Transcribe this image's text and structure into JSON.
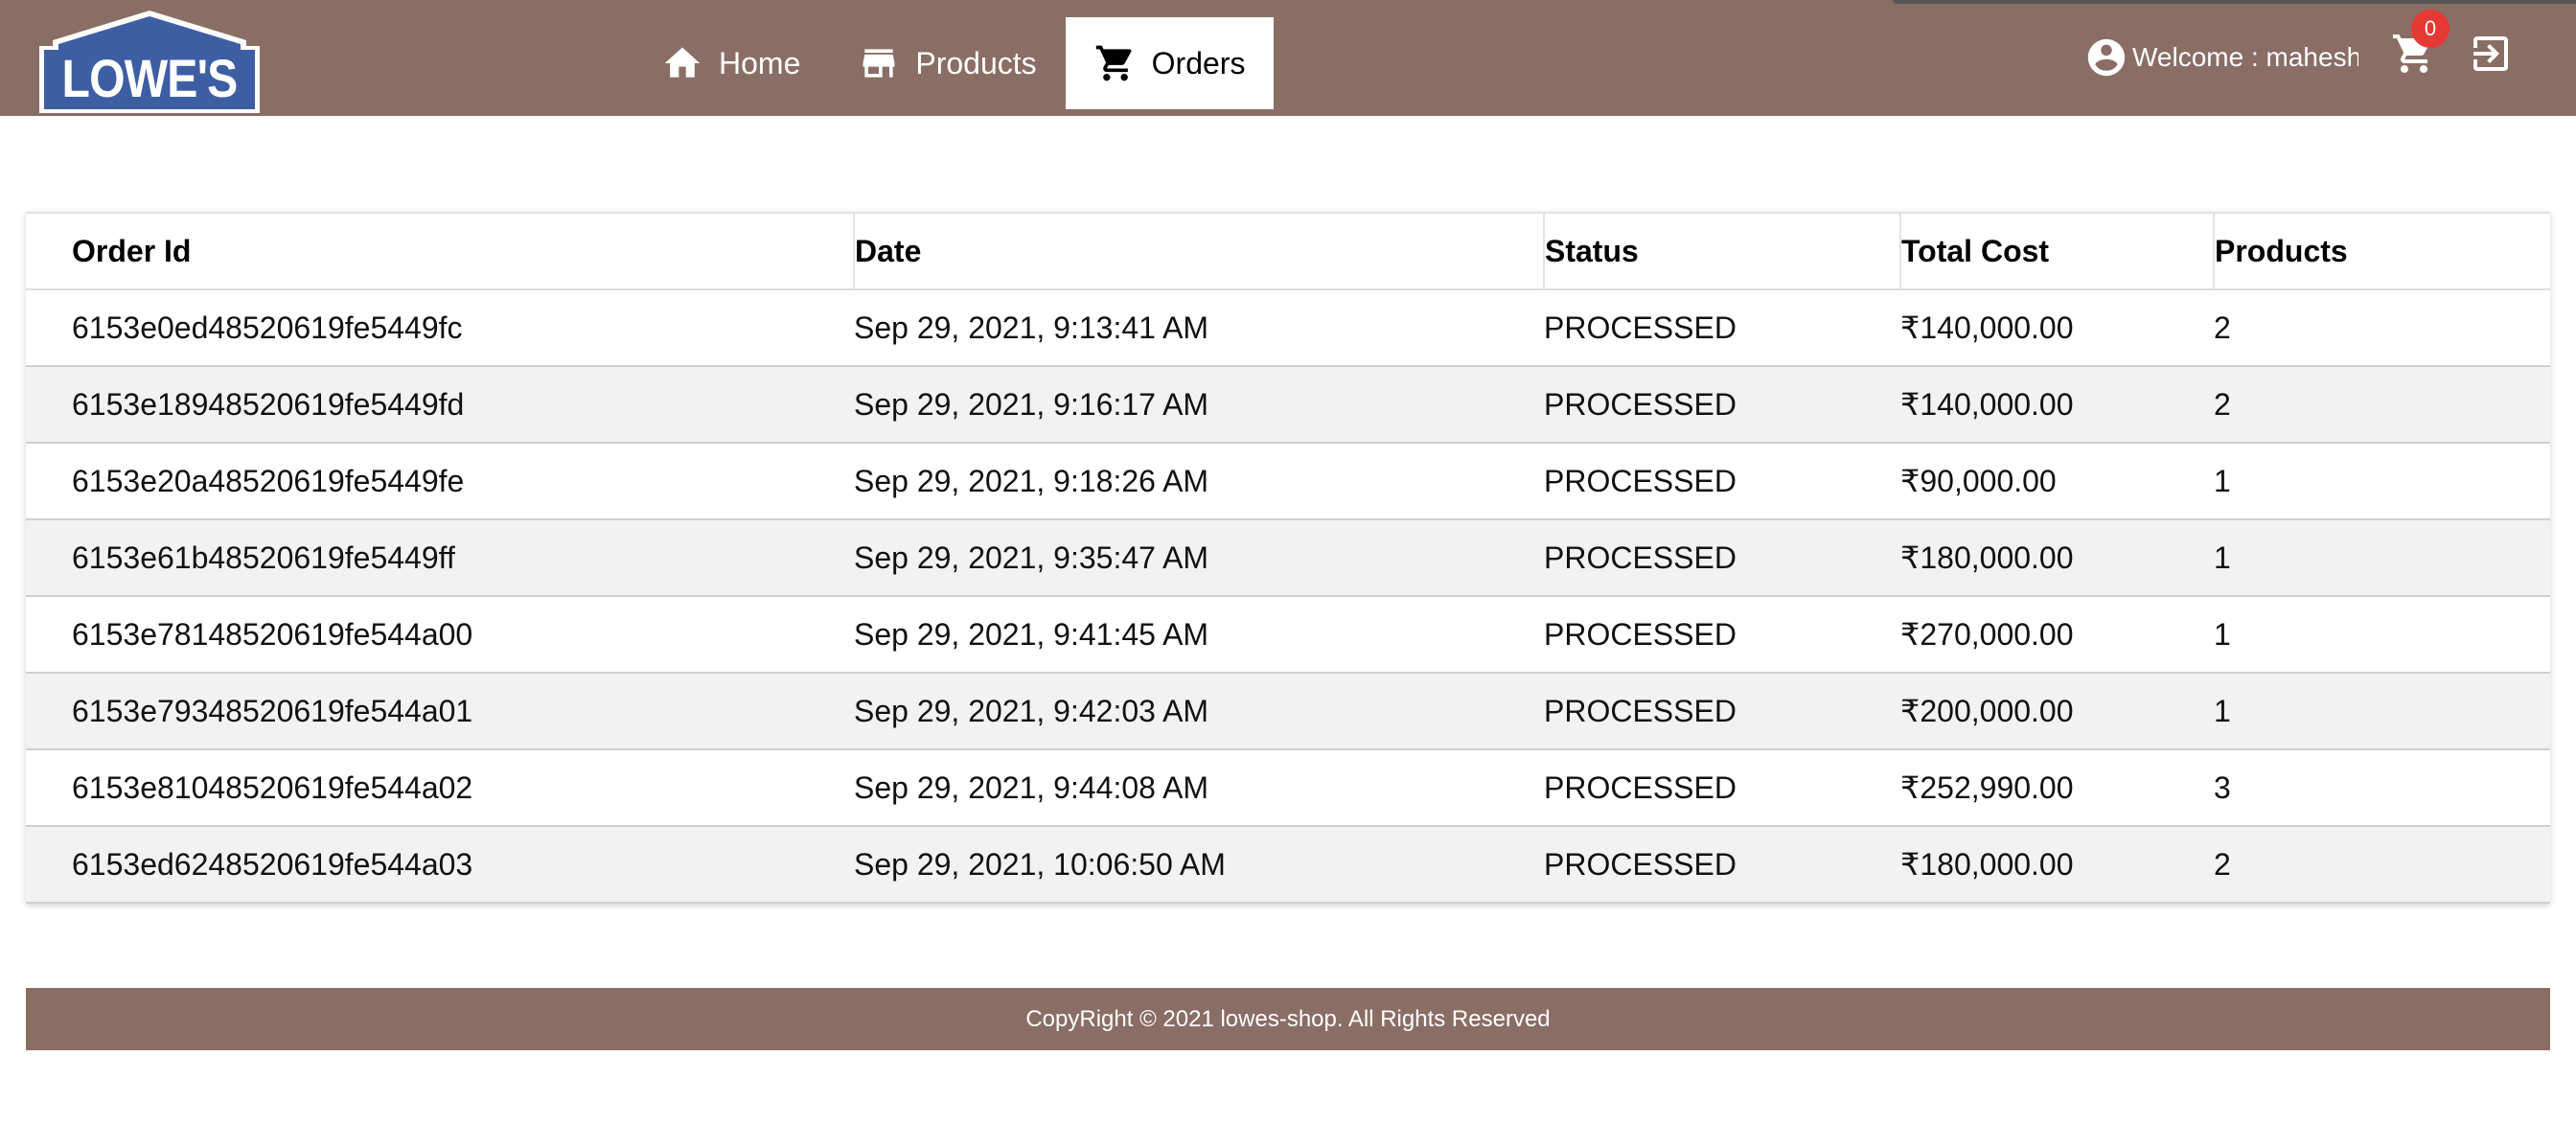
{
  "brand": {
    "logo_text": "LOWE'S",
    "colors": {
      "header_bg": "#8a6e65",
      "logo_blue": "#3e5ea4",
      "badge_red": "#e53935",
      "active_tab_bg": "#ffffff"
    }
  },
  "nav": {
    "items": [
      {
        "label": "Home",
        "icon": "home-icon"
      },
      {
        "label": "Products",
        "icon": "store-icon"
      },
      {
        "label": "Orders",
        "icon": "shopping-cart-icon",
        "active": true
      }
    ]
  },
  "user": {
    "welcome": "Welcome : mahesh",
    "cart_count": "0",
    "icons": [
      "account-circle-icon",
      "cart-icon",
      "logout-icon"
    ]
  },
  "orders": {
    "columns": [
      "Order Id",
      "Date",
      "Status",
      "Total Cost",
      "Products"
    ],
    "rows": [
      [
        "6153e0ed48520619fe5449fc",
        "Sep 29, 2021, 9:13:41 AM",
        "PROCESSED",
        "₹140,000.00",
        "2"
      ],
      [
        "6153e18948520619fe5449fd",
        "Sep 29, 2021, 9:16:17 AM",
        "PROCESSED",
        "₹140,000.00",
        "2"
      ],
      [
        "6153e20a48520619fe5449fe",
        "Sep 29, 2021, 9:18:26 AM",
        "PROCESSED",
        "₹90,000.00",
        "1"
      ],
      [
        "6153e61b48520619fe5449ff",
        "Sep 29, 2021, 9:35:47 AM",
        "PROCESSED",
        "₹180,000.00",
        "1"
      ],
      [
        "6153e78148520619fe544a00",
        "Sep 29, 2021, 9:41:45 AM",
        "PROCESSED",
        "₹270,000.00",
        "1"
      ],
      [
        "6153e79348520619fe544a01",
        "Sep 29, 2021, 9:42:03 AM",
        "PROCESSED",
        "₹200,000.00",
        "1"
      ],
      [
        "6153e81048520619fe544a02",
        "Sep 29, 2021, 9:44:08 AM",
        "PROCESSED",
        "₹252,990.00",
        "3"
      ],
      [
        "6153ed6248520619fe544a03",
        "Sep 29, 2021, 10:06:50 AM",
        "PROCESSED",
        "₹180,000.00",
        "2"
      ]
    ]
  },
  "footer": {
    "text": "CopyRight © 2021 lowes-shop. All Rights Reserved"
  }
}
